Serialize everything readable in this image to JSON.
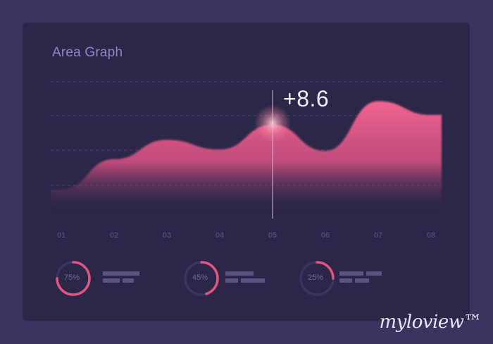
{
  "card": {
    "title": "Area Graph"
  },
  "chart_data": {
    "type": "area",
    "title": "Area Graph",
    "categories": [
      "01",
      "02",
      "03",
      "04",
      "05",
      "06",
      "07",
      "08"
    ],
    "values": [
      2.2,
      4.4,
      5.8,
      5.1,
      6.9,
      5.0,
      8.6,
      7.6
    ],
    "highlight": {
      "category": "05",
      "label": "+8.6"
    },
    "ylim": [
      0,
      10
    ],
    "grid": true,
    "colors": {
      "fill": "#f2648f",
      "highlight_line": "#d9b6d4",
      "grid": "#4a4470"
    }
  },
  "stats": [
    {
      "label": "75%",
      "fraction": 0.75
    },
    {
      "label": "45%",
      "fraction": 0.45
    },
    {
      "label": "25%",
      "fraction": 0.25
    }
  ],
  "watermark": {
    "brand": "myloview™"
  }
}
